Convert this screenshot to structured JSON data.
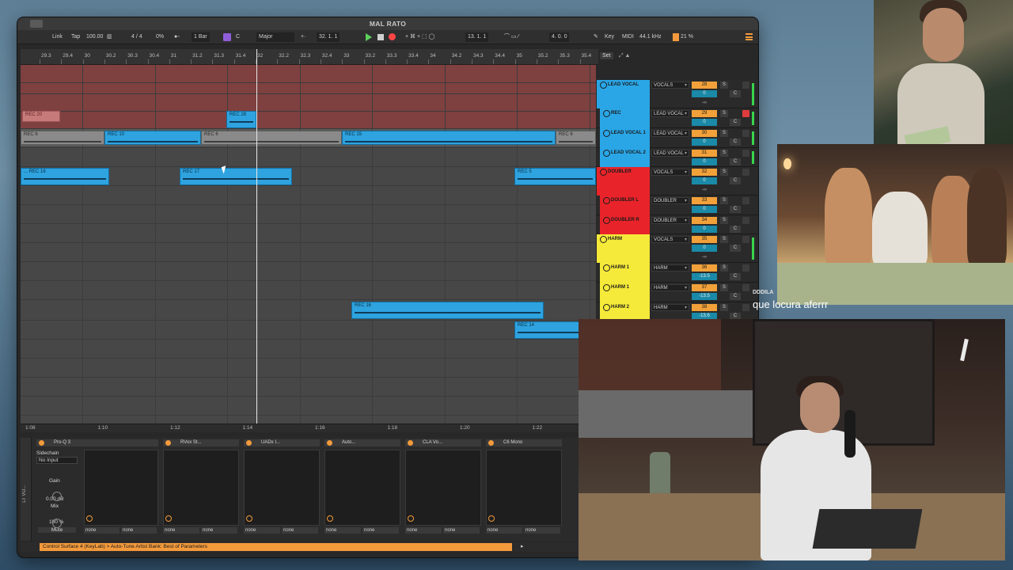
{
  "window": {
    "title": "MAL RATO"
  },
  "transport": {
    "link": "Link",
    "tap": "Tap",
    "tempo": "100.00",
    "signature": "4 / 4",
    "swing": "0%",
    "quantize": "1 Bar",
    "key_root": "C",
    "key_scale": "Major",
    "position": "32.  1.  1",
    "loop_start": "13.  1.  1",
    "loop_length": "4.  0.  0",
    "key_label": "Key",
    "midi_label": "MIDI",
    "sample_rate": "44.1 kHz",
    "cpu": "21 %",
    "set_label": "Set"
  },
  "ruler": {
    "bars": [
      "29.3",
      "29.4",
      "30",
      "30.2",
      "30.3",
      "30.4",
      "31",
      "31.2",
      "31.3",
      "31.4",
      "32",
      "32.2",
      "32.3",
      "32.4",
      "33",
      "33.2",
      "33.3",
      "33.4",
      "34",
      "34.2",
      "34.3",
      "34.4",
      "35",
      "35.2",
      "35.3",
      "35.4"
    ]
  },
  "time_ruler": {
    "times": [
      "1:08",
      "1:10",
      "1:12",
      "1:14",
      "1:16",
      "1:18",
      "1:20",
      "1:22"
    ]
  },
  "clips": {
    "rec20": "REC 20",
    "rec28": "REC 28",
    "rec6a": "REC 6",
    "rec10": "REC 10",
    "rec6b": "REC 6",
    "rec15": "REC 15",
    "rec6c": "REC 6",
    "rec16a": "... REC 16",
    "rec17": "REC 17",
    "rec5": "REC 5",
    "rec16b": "REC 16",
    "rec14": "REC 14"
  },
  "tracks": [
    {
      "name": "LEAD VOCAL",
      "routing": "VOCALS",
      "num": "28",
      "vol": "0",
      "color": "#2aa6e6"
    },
    {
      "name": "REC",
      "routing": "LEAD VOCAL",
      "num": "29",
      "vol": "0",
      "color": "#2aa6e6"
    },
    {
      "name": "LEAD VOCAL 1",
      "routing": "LEAD VOCAL",
      "num": "30",
      "vol": "0",
      "color": "#2aa6e6"
    },
    {
      "name": "LEAD VOCAL 2",
      "routing": "LEAD VOCAL",
      "num": "31",
      "vol": "0",
      "color": "#2aa6e6"
    },
    {
      "name": "DOUBLER",
      "routing": "VOCALS",
      "num": "32",
      "vol": "0",
      "color": "#e8242a"
    },
    {
      "name": "DOUBLER L",
      "routing": "DOUBLER",
      "num": "33",
      "vol": "0",
      "color": "#e8242a"
    },
    {
      "name": "DOUBLER R",
      "routing": "DOUBLER",
      "num": "34",
      "vol": "0",
      "color": "#e8242a"
    },
    {
      "name": "HARM",
      "routing": "VOCALS",
      "num": "35",
      "vol": "0",
      "color": "#f5e93a"
    },
    {
      "name": "HARM 1",
      "routing": "HARM",
      "num": "36",
      "vol": "-13.5",
      "color": "#f5e93a"
    },
    {
      "name": "HARM 1",
      "routing": "HARM",
      "num": "37",
      "vol": "-13.5",
      "color": "#f5e93a"
    },
    {
      "name": "HARM 2",
      "routing": "HARM",
      "num": "38",
      "vol": "-13.6",
      "color": "#f5e93a"
    }
  ],
  "mixer_labels": {
    "solo": "S",
    "center": "C",
    "inf": "-∞"
  },
  "devices": {
    "names": [
      "Pro-Q 3",
      "RVox St...",
      "UADx I...",
      "Auto...",
      "CLA Vo...",
      "C6 Mono"
    ],
    "sidechain_label": "Sidechain",
    "sidechain_input": "No Input",
    "gain_label": "Gain",
    "gain_value": "0.00 dB",
    "mix_label": "Mix",
    "mix_value": "100 %",
    "mute_label": "Mute",
    "none": "none",
    "chain_name": "LT VO..."
  },
  "status": {
    "text": "Control Surface 4 (KeyLab) > Auto-Tune Artist Bank: Best of Parameters"
  },
  "chat": {
    "username": "DDDILA",
    "message": "que locura aferrr"
  }
}
